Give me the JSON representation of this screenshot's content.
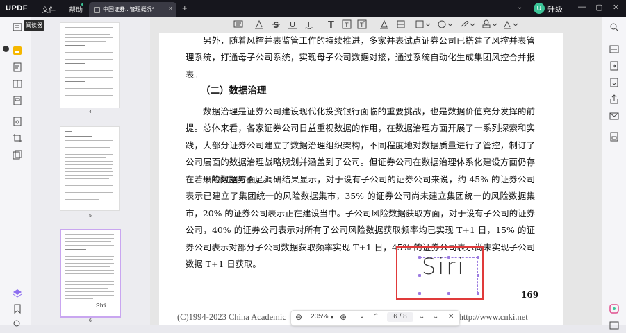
{
  "app": {
    "logo": "UPDF"
  },
  "menu": {
    "file": "文件",
    "help": "帮助"
  },
  "tab": {
    "title": "中国证券...管理概况*",
    "close": "×"
  },
  "topbar": {
    "new_tab": "+",
    "dropdown": "⌄",
    "upgrade_badge": "U",
    "upgrade_label": "升级",
    "minimize": "—",
    "maximize": "▢",
    "close": "✕"
  },
  "tooltip": "阅读器",
  "thumbnails": [
    {
      "page_number": "4"
    },
    {
      "page_number": "5"
    },
    {
      "page_number": "6",
      "signature": "Siri",
      "active": true
    }
  ],
  "toolbar": {
    "icons": [
      "comment-icon",
      "highlight-icon",
      "strikethrough-icon",
      "underline-icon",
      "squiggly-icon",
      "text-icon",
      "textbox-icon",
      "text-callout-icon",
      "pencil-icon",
      "eraser-icon",
      "shape-icon",
      "sticker-icon",
      "attach-icon",
      "stamp-icon",
      "signature-icon"
    ]
  },
  "document": {
    "para1": "另外，随着风控并表监管工作的持续推进，多家并表试点证券公司已搭建了风控并表管理系统，打通母子公司系统，实现母子公司数据对接，通过系统自动化生成集团风控合并报表。",
    "heading": "（二）数据治理",
    "para2": "数据治理是证券公司建设现代化投资银行面临的重要挑战，也是数据价值充分发挥的前提。总体来看，各家证券公司日益重视数据的作用，在数据治理方面开展了一系列探索和实践，大部分证券公司建立了数据治理组织架构，不同程度地对数据质量进行了管控，制订了公司层面的数据治理战略规划并涵盖到子公司。但证券公司在数据治理体系化建设方面仍存在若干的问题与不足。",
    "para3": "风险数据方面，调研结果显示，对于设有子公司的证券公司来说，约 45% 的证券公司表示已建立了集团统一的风险数据集市，35% 的证券公司尚未建立集团统一的风险数据集市，20% 的证券公司表示正在建设当中。子公司风险数据获取方面，对于设有子公司的证券公司，40% 的证券公司表示对所有子公司风险数据获取频率均已实现 T+1 日，15% 的证券公司表示对部分子公司数据获取频率实现 T+1 日，45% 的证券公司表示尚未实现子公司数据 T+1 日获取。",
    "page_number": "169",
    "footer_left": "(C)1994-2023 China Academic",
    "footer_right": "s reserved.    http://www.cnki.net",
    "signature": "Siri"
  },
  "bottom_bar": {
    "zoom_out": "⊖",
    "zoom": "205%",
    "zoom_dropdown": "▾",
    "zoom_in": "⊕",
    "first_page": "⌅",
    "prev_page": "⌃",
    "current_page": "6",
    "separator": "/",
    "total_pages": "8",
    "next_page": "⌄",
    "last_page": "⌄",
    "close": "✕"
  }
}
